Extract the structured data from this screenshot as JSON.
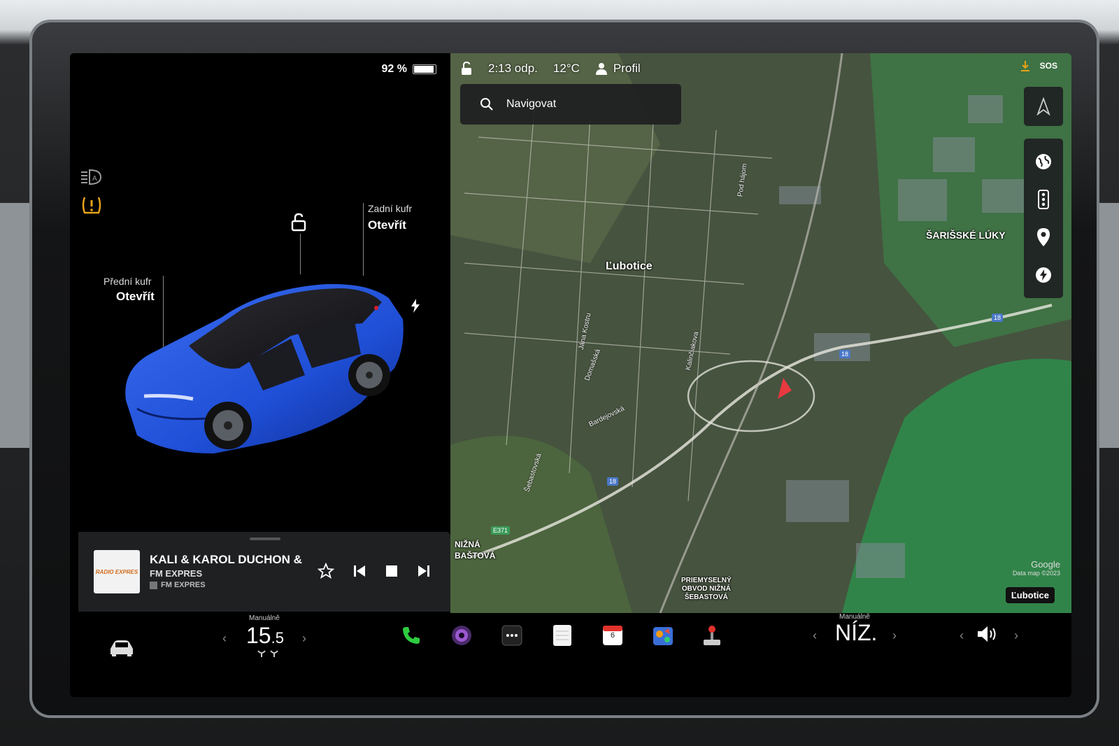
{
  "status": {
    "battery_percent": "92 %",
    "battery_level": 0.92,
    "time": "2:13 odp.",
    "temperature": "12°C",
    "profile": "Profil"
  },
  "car": {
    "front_trunk_label": "Přední kufr",
    "front_trunk_value": "Otevřít",
    "rear_trunk_label": "Zadní kufr",
    "rear_trunk_value": "Otevřít",
    "body_color": "#1f4fd6"
  },
  "media": {
    "song": "KALI & KAROL DUCHON &",
    "station": "FM EXPRES",
    "source": "FM EXPRES",
    "album_art_text": "RADIO EXPRES"
  },
  "map": {
    "search_placeholder": "Navigovat",
    "sos": "SOS",
    "places": {
      "lubotice": "Ľubotice",
      "sarisske_luky": "ŠARIŠSKÉ LÚKY",
      "nizna_bastova": "NIŽNÁ\nBAŠTOVÁ",
      "priemyselny": "PRIEMYSELNÝ\nOBVOD NIŽNÁ\nŠEBASTOVÁ"
    },
    "streets": {
      "pod_hajom": "Pod hájom",
      "jana_kostru": "Jána Kostru",
      "domasska": "Domašská",
      "kalinciakova": "Kalinčiakova",
      "bardejovska": "Bardejovská",
      "sebastovska": "Šebastovská"
    },
    "road_numbers": [
      "18",
      "18",
      "18",
      "E371"
    ],
    "attribution_google": "Google",
    "attribution_data": "Data map ©2023",
    "location_badge": "Ľubotice"
  },
  "dock": {
    "driver_mode_label": "Manuálně",
    "driver_temp_main": "15",
    "driver_temp_decimal": ".5",
    "passenger_mode_label": "Manuálně",
    "passenger_temp": "NÍZ.",
    "calendar_day": "6"
  }
}
